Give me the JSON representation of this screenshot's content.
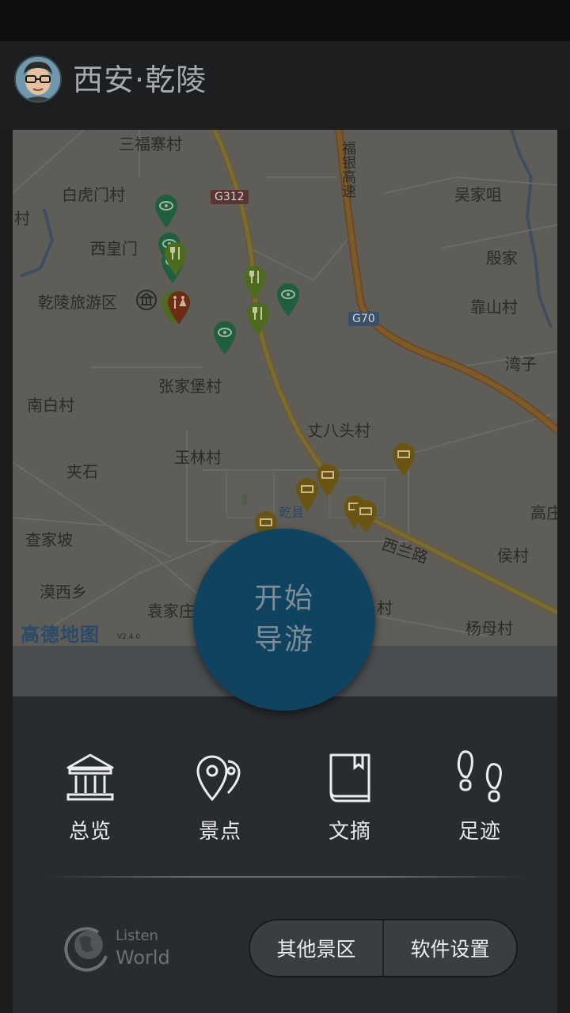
{
  "header": {
    "title": "西安·乾陵"
  },
  "map": {
    "brand": "高德地图",
    "version": "V2.4.0",
    "labels": {
      "sanfuzhai": "三福寨村",
      "baihumen": "白虎门村",
      "cun": "村",
      "xihuangmen": "西皇门",
      "qianling": "乾陵旅游区",
      "fuyin": "福银高速",
      "wujiazui": "吴家咀",
      "yinjia": "殷家",
      "kaoshan": "靠山村",
      "wanzi": "湾子",
      "nanbai": "南白村",
      "zhangjiabao": "张家堡村",
      "zhangbatou": "丈八头村",
      "jiashi": "夹石",
      "yulin": "玉林村",
      "chajiapo": "查家坡",
      "gao": "高庄",
      "houcun": "侯村",
      "moxixiang": "漠西乡",
      "yuanjiazhuang": "袁家庄",
      "cun2": "村",
      "yangmu": "杨母村",
      "xilanlu": "西兰路",
      "qianxian": "乾县",
      "g312": "G312",
      "g70": "G70"
    }
  },
  "start_button": {
    "line1": "开始",
    "line2": "导游"
  },
  "nav": [
    {
      "label": "总览",
      "icon": "museum-icon"
    },
    {
      "label": "景点",
      "icon": "location-pins-icon"
    },
    {
      "label": "文摘",
      "icon": "book-icon"
    },
    {
      "label": "足迹",
      "icon": "footprints-icon"
    }
  ],
  "logo": {
    "line1": "Listen",
    "line2": "World"
  },
  "actions": {
    "other_areas": "其他景区",
    "settings": "软件设置"
  },
  "colors": {
    "accent": "#0f4360",
    "panel": "#282c2f",
    "header": "#1c1e20"
  }
}
